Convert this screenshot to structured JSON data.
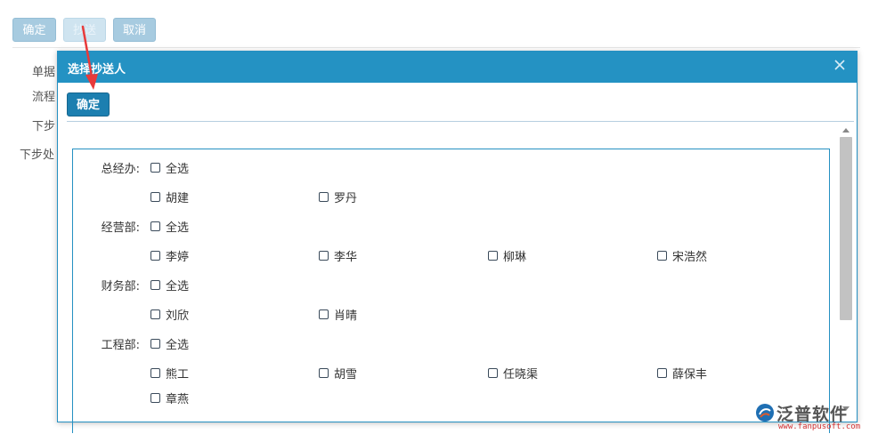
{
  "toolbar": {
    "confirm_label": "确定",
    "cc_label": "抄送",
    "cancel_label": "取消"
  },
  "background_labels": [
    "单据",
    "流程",
    "下步",
    "下步处"
  ],
  "dialog": {
    "title": "选择抄送人",
    "confirm_label": "确定",
    "departments": [
      {
        "name": "总经办:",
        "select_all": "全选",
        "members": [
          "胡建",
          "罗丹"
        ]
      },
      {
        "name": "经营部:",
        "select_all": "全选",
        "members": [
          "李婷",
          "李华",
          "柳琳",
          "宋浩然"
        ]
      },
      {
        "name": "财务部:",
        "select_all": "全选",
        "members": [
          "刘欣",
          "肖晴"
        ]
      },
      {
        "name": "工程部:",
        "select_all": "全选",
        "members": [
          "熊工",
          "胡雪",
          "任晓渠",
          "薛保丰",
          "章燕"
        ]
      }
    ]
  },
  "watermark": {
    "brand": "泛普软件",
    "url": "www.fanpusoft.com"
  },
  "colors": {
    "header": "#2492c3",
    "button": "#1c7fb0",
    "annotation_arrow": "#e83a3a"
  }
}
